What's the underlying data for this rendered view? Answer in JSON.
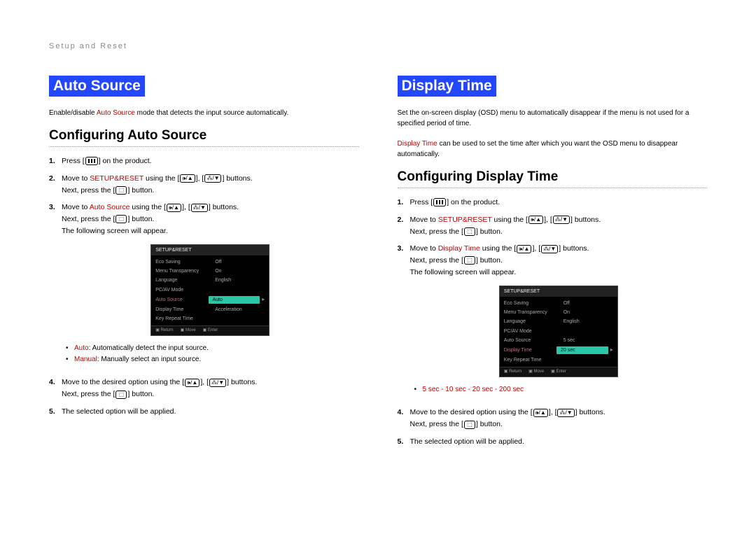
{
  "header": "Setup and Reset",
  "left": {
    "title": "Auto Source",
    "intro_pre": "Enable/disable ",
    "intro_red": "Auto Source",
    "intro_post": " mode that detects the input source automatically.",
    "subheading": "Configuring Auto Source",
    "step1": "Press [",
    "step1_post": "] on the product.",
    "step2_pre": "Move to ",
    "step2_red": "SETUP&RESET",
    "step2_mid": " using the [",
    "step2_btw": "], [",
    "step2_post": "] buttons.",
    "step2_line2a": "Next, press the [",
    "step2_line2b": "] button.",
    "step3_pre": "Move to ",
    "step3_red": "Auto Source",
    "step3_mid": " using the [",
    "step3_btw": "], [",
    "step3_post": "] buttons.",
    "step3_line2a": "Next, press the [",
    "step3_line2b": "] button.",
    "step3_line3": "The following screen will appear.",
    "osd": {
      "title": "SETUP&RESET",
      "rows": [
        {
          "k": "Eco Saving",
          "v": "Off"
        },
        {
          "k": "Menu Transparency",
          "v": "On"
        },
        {
          "k": "Language",
          "v": "English"
        },
        {
          "k": "PC/AV Mode",
          "v": ""
        },
        {
          "k": "Auto Source",
          "v": "Auto"
        },
        {
          "k": "Display Time",
          "v": "Acceleration"
        },
        {
          "k": "Key Repeat Time",
          "v": ""
        }
      ],
      "active_index": 4,
      "foot": [
        "Return",
        "Move",
        "Enter"
      ]
    },
    "bullet1_red": "Auto",
    "bullet1_txt": ": Automatically detect the input source.",
    "bullet2_red": "Manual",
    "bullet2_txt": ": Manually select an input source.",
    "step4_pre": "Move to the desired option using the [",
    "step4_btw": "], [",
    "step4_post": "] buttons.",
    "step4_line2a": "Next, press the [",
    "step4_line2b": "] button.",
    "step5": "The selected option will be applied."
  },
  "right": {
    "title": "Display Time",
    "intro1": "Set the on-screen display (OSD) menu to automatically disappear if the menu is not used for a specified period of time.",
    "intro2_red": "Display Time",
    "intro2_post": " can be used to set the time after which you want the OSD menu to disappear automatically.",
    "subheading": "Configuring Display Time",
    "step1": "Press [",
    "step1_post": "] on the product.",
    "step2_pre": "Move to ",
    "step2_red": "SETUP&RESET",
    "step2_mid": " using the [",
    "step2_btw": "], [",
    "step2_post": "] buttons.",
    "step2_line2a": "Next, press the [",
    "step2_line2b": "] button.",
    "step3_pre": "Move to ",
    "step3_red": "Display Time",
    "step3_mid": " using the [",
    "step3_btw": "], [",
    "step3_post": "] buttons.",
    "step3_line2a": "Next, press the [",
    "step3_line2b": "] button.",
    "step3_line3": "The following screen will appear.",
    "osd": {
      "title": "SETUP&RESET",
      "rows": [
        {
          "k": "Eco Saving",
          "v": "Off"
        },
        {
          "k": "Menu Transparency",
          "v": "On"
        },
        {
          "k": "Language",
          "v": "English"
        },
        {
          "k": "PC/AV Mode",
          "v": ""
        },
        {
          "k": "Auto Source",
          "v": "5 sec"
        },
        {
          "k": "Display Time",
          "v": "20 sec"
        },
        {
          "k": "Key Repeat Time",
          "v": ""
        }
      ],
      "active_index": 5,
      "foot": [
        "Return",
        "Move",
        "Enter"
      ]
    },
    "bullet_red": "5 sec - 10 sec - 20 sec - 200 sec",
    "step4_pre": "Move to the desired option using the [",
    "step4_btw": "], [",
    "step4_post": "] buttons.",
    "step4_line2a": "Next, press the [",
    "step4_line2b": "] button.",
    "step5": "The selected option will be applied."
  },
  "icons": {
    "menu": "▥",
    "volup": "🕪/▲",
    "voldown": "⁂/▼",
    "enter": "⏎"
  }
}
